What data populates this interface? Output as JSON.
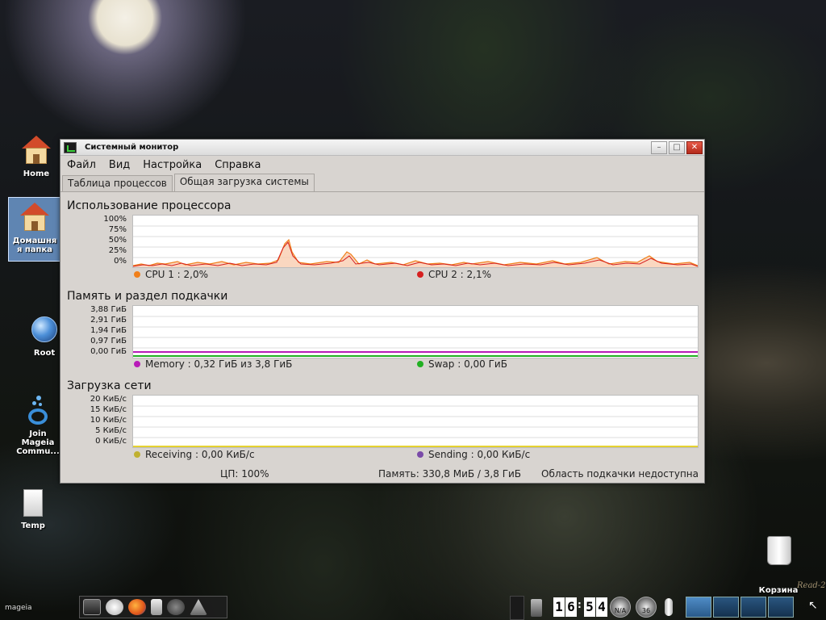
{
  "desktop": {
    "icons": [
      {
        "label": "Home"
      },
      {
        "label": "Домашня\nя папка"
      },
      {
        "label": "Root"
      },
      {
        "label": "Join\nMageia\nCommu..."
      },
      {
        "label": "Temp"
      },
      {
        "label": "Корзина"
      }
    ],
    "corner_logo": "mageia",
    "wallpaper_signature": "Read-2"
  },
  "window": {
    "title": "Системный монитор",
    "buttons": {
      "minimize": "–",
      "maximize": "□",
      "close": "✕"
    },
    "menu": [
      {
        "label": "Файл"
      },
      {
        "label": "Вид"
      },
      {
        "label": "Настройка"
      },
      {
        "label": "Справка"
      }
    ],
    "tabs": [
      {
        "label": "Таблица процессов",
        "active": false
      },
      {
        "label": "Общая загрузка системы",
        "active": true
      }
    ],
    "cpu": {
      "title": "Использование процессора",
      "yticks": [
        "100%",
        "75%",
        "50%",
        "25%",
        "0%"
      ],
      "legend": [
        {
          "label": "CPU 1 : 2,0%",
          "color": "#f07f1a"
        },
        {
          "label": "CPU 2 : 2,1%",
          "color": "#d62020"
        }
      ]
    },
    "memory": {
      "title": "Память и раздел подкачки",
      "yticks": [
        "3,88 ГиБ",
        "2,91 ГиБ",
        "1,94 ГиБ",
        "0,97 ГиБ",
        "0,00 ГиБ"
      ],
      "legend": [
        {
          "label": "Memory : 0,32 ГиБ из 3,8 ГиБ",
          "color": "#b81bb8"
        },
        {
          "label": "Swap : 0,00 ГиБ",
          "color": "#22b022"
        }
      ]
    },
    "network": {
      "title": "Загрузка сети",
      "yticks": [
        "20 КиБ/с",
        "15 КиБ/с",
        "10 КиБ/с",
        "5 КиБ/с",
        "0 КиБ/с"
      ],
      "legend": [
        {
          "label": "Receiving : 0,00 КиБ/с",
          "color": "#c0b030"
        },
        {
          "label": "Sending : 0,00 КиБ/с",
          "color": "#7a4aa8"
        }
      ]
    },
    "status": {
      "cpu": "ЦП: 100%",
      "memory": "Память: 330,8 МиБ / 3,8 ГиБ",
      "swap": "Область подкачки недоступна"
    }
  },
  "taskbar": {
    "clock": {
      "h1": "1",
      "h2": "6",
      "sep": ":",
      "m1": "5",
      "m2": "4"
    },
    "gauge1_label": "N/A",
    "gauge2_label": "36",
    "pager_count": 4
  }
}
